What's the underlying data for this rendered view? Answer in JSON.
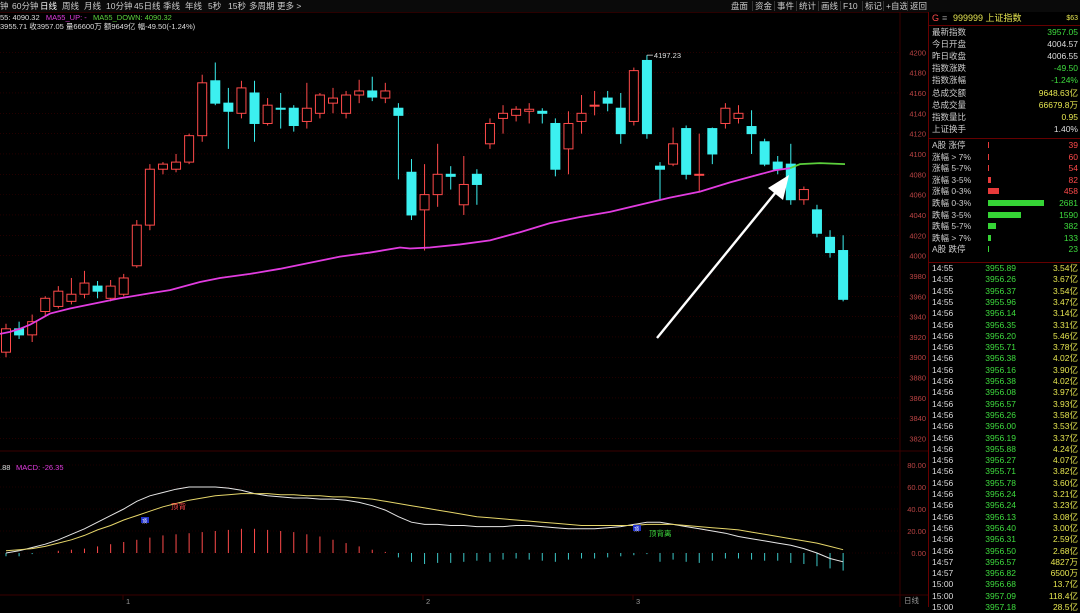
{
  "colors": {
    "up": "#ff4a4a",
    "down": "#3cf0f0",
    "ma_up": "#e23ce0",
    "ma_down": "#5cd03c",
    "grid": "#3a0000",
    "dif": "#e6e6e6",
    "dea": "#e6d66a"
  },
  "toolbar": {
    "periods": [
      "钟",
      "60分钟",
      "日线",
      "周线",
      "月线",
      "10分钟",
      "45日线",
      "季线",
      "年线",
      "5秒",
      "15秒",
      "多周期",
      "更多 >"
    ],
    "active_period": "日线",
    "right_buttons": [
      "盘面",
      "资金",
      "事件",
      "统计",
      "画线",
      "F10",
      "标记",
      "+自选",
      "返回"
    ]
  },
  "header": {
    "line1_value": "55: 4090.32",
    "ma_up": "MA55_UP: -",
    "ma_down": "MA55_DOWN: 4090.32",
    "line2": "3955.71 收3957.05 量66600万 额9649亿 幅-49.50(-1.24%)"
  },
  "macd": {
    "label_val": ".88",
    "label": "MACD: -26.35",
    "anno_top": "顶",
    "anno_red": "顶背",
    "anno_top2": "顶",
    "anno_green": "顶背离"
  },
  "chart_data": {
    "type": "candlestick",
    "ylim": [
      3800,
      4220
    ],
    "y_ticks": [
      3820,
      3840,
      3860,
      3880,
      3900,
      3920,
      3940,
      3960,
      3980,
      4000,
      4020,
      4040,
      4060,
      4080,
      4100,
      4120,
      4140,
      4160,
      4180,
      4200
    ],
    "high_annotation": "4197.23",
    "candles": [
      [
        3905,
        3928,
        3900,
        3933
      ],
      [
        3928,
        3922,
        3918,
        3935
      ],
      [
        3922,
        3935,
        3915,
        3942
      ],
      [
        3945,
        3958,
        3940,
        3960
      ],
      [
        3950,
        3965,
        3948,
        3970
      ],
      [
        3955,
        3962,
        3952,
        3978
      ],
      [
        3962,
        3973,
        3958,
        3985
      ],
      [
        3970,
        3965,
        3958,
        3975
      ],
      [
        3958,
        3970,
        3955,
        3976
      ],
      [
        3962,
        3978,
        3960,
        3982
      ],
      [
        3990,
        4030,
        3988,
        4035
      ],
      [
        4030,
        4085,
        4025,
        4090
      ],
      [
        4085,
        4090,
        4080,
        4092
      ],
      [
        4085,
        4092,
        4082,
        4100
      ],
      [
        4092,
        4118,
        4090,
        4120
      ],
      [
        4118,
        4170,
        4112,
        4178
      ],
      [
        4172,
        4150,
        4148,
        4190
      ],
      [
        4150,
        4142,
        4105,
        4165
      ],
      [
        4140,
        4165,
        4135,
        4172
      ],
      [
        4160,
        4130,
        4112,
        4172
      ],
      [
        4130,
        4148,
        4128,
        4155
      ],
      [
        4145,
        4144,
        4125,
        4160
      ],
      [
        4145,
        4128,
        4122,
        4148
      ],
      [
        4132,
        4145,
        4125,
        4170
      ],
      [
        4140,
        4158,
        4135,
        4160
      ],
      [
        4150,
        4155,
        4140,
        4165
      ],
      [
        4140,
        4158,
        4135,
        4162
      ],
      [
        4158,
        4162,
        4150,
        4173
      ],
      [
        4162,
        4156,
        4152,
        4176
      ],
      [
        4155,
        4162,
        4150,
        4170
      ],
      [
        4145,
        4138,
        4075,
        4150
      ],
      [
        4082,
        4040,
        4035,
        4095
      ],
      [
        4045,
        4060,
        4005,
        4090
      ],
      [
        4060,
        4080,
        4048,
        4110
      ],
      [
        4080,
        4078,
        4065,
        4088
      ],
      [
        4050,
        4070,
        4040,
        4098
      ],
      [
        4080,
        4070,
        4050,
        4085
      ],
      [
        4110,
        4130,
        4105,
        4135
      ],
      [
        4135,
        4140,
        4120,
        4148
      ],
      [
        4138,
        4144,
        4132,
        4147
      ],
      [
        4142,
        4144,
        4130,
        4150
      ],
      [
        4142,
        4140,
        4130,
        4145
      ],
      [
        4130,
        4085,
        4078,
        4135
      ],
      [
        4105,
        4130,
        4080,
        4142
      ],
      [
        4132,
        4140,
        4120,
        4158
      ],
      [
        4148,
        4148,
        4138,
        4162
      ],
      [
        4155,
        4150,
        4142,
        4162
      ],
      [
        4145,
        4120,
        4110,
        4160
      ],
      [
        4132,
        4182,
        4128,
        4185
      ],
      [
        4192,
        4120,
        4115,
        4197.23
      ],
      [
        4088,
        4085,
        4055,
        4092
      ],
      [
        4090,
        4110,
        4088,
        4126
      ],
      [
        4125,
        4080,
        4075,
        4128
      ],
      [
        4080,
        4080,
        4062,
        4120
      ],
      [
        4125,
        4100,
        4090,
        4126
      ],
      [
        4130,
        4145,
        4125,
        4150
      ],
      [
        4135,
        4140,
        4130,
        4148
      ],
      [
        4127,
        4120,
        4100,
        4143
      ],
      [
        4112,
        4090,
        4088,
        4115
      ],
      [
        4092,
        4085,
        4080,
        4098
      ],
      [
        4090,
        4055,
        4050,
        4110
      ],
      [
        4055,
        4065,
        4050,
        4068
      ],
      [
        4045,
        4022,
        4018,
        4050
      ],
      [
        4018,
        4003,
        3998,
        4025
      ],
      [
        4005,
        3957,
        3955,
        4020
      ]
    ],
    "ma_points": [
      [
        0,
        3923
      ],
      [
        10,
        3925
      ],
      [
        20,
        3928
      ],
      [
        30,
        3932
      ],
      [
        50,
        3943
      ],
      [
        70,
        3948
      ],
      [
        100,
        3954
      ],
      [
        120,
        3958
      ],
      [
        150,
        3963
      ],
      [
        170,
        3966
      ],
      [
        200,
        3974
      ],
      [
        220,
        3978
      ],
      [
        250,
        3982
      ],
      [
        280,
        3987
      ],
      [
        310,
        3993
      ],
      [
        340,
        3999
      ],
      [
        370,
        4003
      ],
      [
        400,
        4008
      ],
      [
        410,
        4007
      ],
      [
        430,
        4008
      ],
      [
        460,
        4011
      ],
      [
        490,
        4015
      ],
      [
        520,
        4023
      ],
      [
        550,
        4032
      ],
      [
        580,
        4038
      ],
      [
        610,
        4043
      ],
      [
        640,
        4050
      ],
      [
        670,
        4057
      ],
      [
        700,
        4063
      ],
      [
        730,
        4072
      ],
      [
        760,
        4080
      ],
      [
        775,
        4084
      ],
      [
        790,
        4086
      ],
      [
        800,
        4090
      ],
      [
        820,
        4091
      ],
      [
        845,
        4090
      ]
    ],
    "ma_color_switch_x": 795,
    "macd_ticks": [
      "80.00",
      "60.00",
      "40.00",
      "20.00",
      "0.00"
    ],
    "macd_hist": [
      -3,
      -3,
      -1,
      0,
      2,
      3,
      4,
      6,
      8,
      10,
      12,
      14,
      16,
      17,
      18,
      19,
      20,
      21,
      22,
      22,
      21,
      20,
      19,
      17,
      15,
      12,
      9,
      6,
      3,
      1,
      -4,
      -8,
      -10,
      -9,
      -9,
      -8,
      -7,
      -8,
      -6,
      -5,
      -6,
      -7,
      -8,
      -6,
      -5,
      -5,
      -4,
      -3,
      -2,
      -1,
      -8,
      -6,
      -8,
      -9,
      -7,
      -5,
      -5,
      -6,
      -7,
      -7,
      -9,
      -10,
      -12,
      -14,
      -16
    ],
    "dif": [
      0,
      2,
      5,
      8,
      12,
      17,
      22,
      28,
      34,
      40,
      47,
      52,
      55,
      58,
      60,
      60,
      60,
      59,
      57,
      54,
      52,
      51,
      50,
      50,
      49,
      49,
      48,
      46,
      43,
      39,
      33,
      28,
      26,
      26,
      25,
      25,
      24,
      24,
      24,
      25,
      25,
      24,
      23,
      22,
      22,
      22,
      23,
      24,
      26,
      28,
      28,
      26,
      24,
      22,
      20,
      18,
      15,
      13,
      11,
      9,
      7,
      4,
      0,
      -5,
      -8
    ],
    "dea": [
      2,
      3,
      4,
      6,
      9,
      12,
      16,
      21,
      25,
      30,
      34,
      38,
      42,
      45,
      48,
      50,
      52,
      53,
      54,
      54,
      54,
      53,
      53,
      52,
      52,
      51,
      51,
      50,
      49,
      47,
      45,
      43,
      41,
      39,
      37,
      35,
      33,
      32,
      31,
      30,
      29,
      28,
      27,
      26,
      25,
      25,
      25,
      25,
      25,
      26,
      26,
      26,
      25,
      24,
      23,
      22,
      21,
      19,
      17,
      15,
      13,
      11,
      9,
      6,
      3
    ],
    "x_labels": [
      "1",
      "2",
      "3"
    ]
  },
  "side": {
    "code_letter": "G",
    "title": "999999 上证指数",
    "badge": "$63",
    "stats": [
      {
        "label": "最新指数",
        "value": "3957.05",
        "color": "grn"
      },
      {
        "label": "今日开盘",
        "value": "4004.57",
        "color": "wht"
      },
      {
        "label": "昨日收盘",
        "value": "4006.55",
        "color": "wht"
      },
      {
        "label": "指数涨跌",
        "value": "-49.50",
        "color": "grn"
      },
      {
        "label": "指数涨幅",
        "value": "-1.24%",
        "color": "grn"
      },
      {
        "label": "总成交额",
        "value": "9648.63亿",
        "color": "yel"
      },
      {
        "label": "总成交量",
        "value": "66679.8万",
        "color": "yel"
      },
      {
        "label": "指数量比",
        "value": "0.95",
        "color": "yel"
      },
      {
        "label": "上证换手",
        "value": "1.40%",
        "color": "wht"
      }
    ],
    "breadth": [
      {
        "label": "A股 涨停",
        "value": "39",
        "color": "red",
        "bar": 0
      },
      {
        "label": "涨幅 > 7%",
        "value": "60",
        "color": "red",
        "bar": 1
      },
      {
        "label": "涨幅 5-7%",
        "value": "54",
        "color": "red",
        "bar": 1
      },
      {
        "label": "涨幅 3-5%",
        "value": "82",
        "color": "red",
        "bar": 3
      },
      {
        "label": "涨幅 0-3%",
        "value": "458",
        "color": "red",
        "bar": 11
      },
      {
        "label": "跌幅 0-3%",
        "value": "2681",
        "color": "grn",
        "bar": 56
      },
      {
        "label": "跌幅 3-5%",
        "value": "1590",
        "color": "grn",
        "bar": 33
      },
      {
        "label": "跌幅 5-7%",
        "value": "382",
        "color": "grn",
        "bar": 8
      },
      {
        "label": "跌幅 > 7%",
        "value": "133",
        "color": "grn",
        "bar": 3
      },
      {
        "label": "A股 跌停",
        "value": "23",
        "color": "grn",
        "bar": 0
      }
    ],
    "ticks": [
      [
        "14:55",
        "3955.89",
        "3.54亿"
      ],
      [
        "14:55",
        "3956.26",
        "3.67亿"
      ],
      [
        "14:55",
        "3956.37",
        "3.54亿"
      ],
      [
        "14:55",
        "3955.96",
        "3.47亿"
      ],
      [
        "14:56",
        "3956.14",
        "3.14亿"
      ],
      [
        "14:56",
        "3956.35",
        "3.31亿"
      ],
      [
        "14:56",
        "3956.20",
        "5.46亿"
      ],
      [
        "14:56",
        "3955.71",
        "3.78亿"
      ],
      [
        "14:56",
        "3956.38",
        "4.02亿"
      ],
      [
        "14:56",
        "3956.16",
        "3.90亿"
      ],
      [
        "14:56",
        "3956.38",
        "4.02亿"
      ],
      [
        "14:56",
        "3956.08",
        "3.97亿"
      ],
      [
        "14:56",
        "3956.57",
        "3.93亿"
      ],
      [
        "14:56",
        "3956.26",
        "3.58亿"
      ],
      [
        "14:56",
        "3956.00",
        "3.53亿"
      ],
      [
        "14:56",
        "3956.19",
        "3.37亿"
      ],
      [
        "14:56",
        "3955.88",
        "4.24亿"
      ],
      [
        "14:56",
        "3956.27",
        "4.07亿"
      ],
      [
        "14:56",
        "3955.71",
        "3.82亿"
      ],
      [
        "14:56",
        "3955.78",
        "3.60亿"
      ],
      [
        "14:56",
        "3956.24",
        "3.21亿"
      ],
      [
        "14:56",
        "3956.24",
        "3.23亿"
      ],
      [
        "14:56",
        "3956.13",
        "3.08亿"
      ],
      [
        "14:56",
        "3956.40",
        "3.00亿"
      ],
      [
        "14:56",
        "3956.31",
        "2.59亿"
      ],
      [
        "14:56",
        "3956.50",
        "2.68亿"
      ],
      [
        "14:57",
        "3956.57",
        "4827万"
      ],
      [
        "14:57",
        "3956.82",
        "6500万"
      ],
      [
        "15:00",
        "3956.68",
        "13.7亿"
      ],
      [
        "15:00",
        "3957.09",
        "118.4亿"
      ],
      [
        "15:00",
        "3957.18",
        "28.5亿"
      ]
    ],
    "bottom_tab": "日线"
  }
}
